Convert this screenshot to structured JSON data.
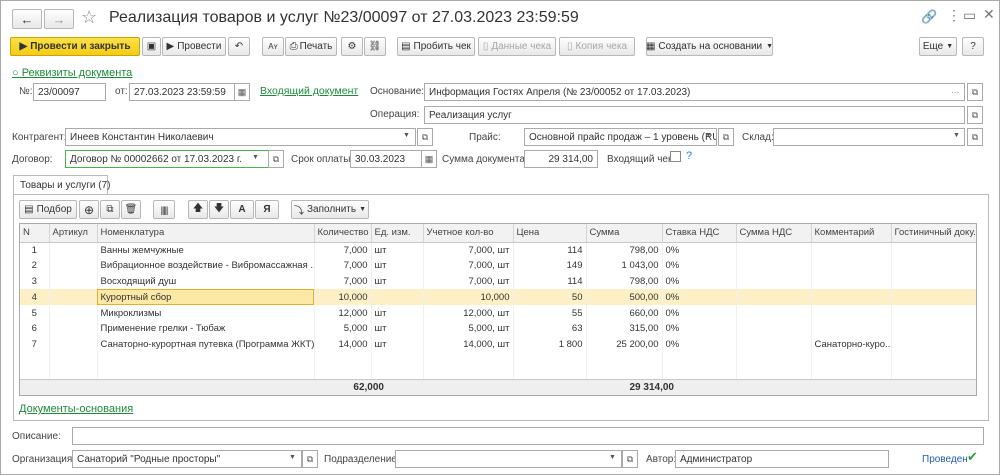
{
  "title": "Реализация товаров и услуг №23/00097 от 27.03.2023 23:59:59",
  "toolbar": {
    "post_close": "Провести и закрыть",
    "post": "Провести",
    "print": "Печать",
    "punch_check": "Пробить чек",
    "check_data": "Данные чека",
    "check_copy": "Копия чека",
    "create_based": "Создать на основании",
    "more": "Еще",
    "help": "?"
  },
  "requisites_link": "○ Реквизиты документа",
  "form": {
    "num_label": "№:",
    "num_value": "23/00097",
    "from_label": "от:",
    "date_value": "27.03.2023 23:59:59",
    "incoming_doc_link": "Входящий документ",
    "basis_label": "Основание:",
    "basis_value": "Информация Гостях Апреля (№ 23/00052 от 17.03.2023)",
    "operation_label": "Операция:",
    "operation_value": "Реализация услуг",
    "contractor_label": "Контрагент:",
    "contractor_value": "Инеев Константин Николаевич",
    "price_label": "Прайс:",
    "price_value": "Основной прайс продаж – 1 уровень (RU",
    "warehouse_label": "Склад:",
    "warehouse_value": "",
    "contract_label": "Договор:",
    "contract_value": "Договор № 00002662 от 17.03.2023 г.",
    "payment_term_label": "Срок оплаты:",
    "payment_term_value": "30.03.2023",
    "doc_sum_label": "Сумма документа:",
    "doc_sum_value": "29 314,00",
    "incoming_check_label": "Входящий чек:",
    "question": "?"
  },
  "tab": "Товары и услуги (7)",
  "table_toolbar": {
    "pick": "Подбор",
    "fill": "Заполнить",
    "a_label": "А",
    "ya_label": "Я"
  },
  "table": {
    "columns": [
      "N",
      "Артикул",
      "Номенклатура",
      "Количество",
      "Ед. изм.",
      "Учетное кол-во",
      "Цена",
      "Сумма",
      "Ставка НДС",
      "Сумма НДС",
      "Комментарий",
      "Гостиничный доку..."
    ],
    "rows": [
      [
        "1",
        "",
        "Ванны жемчужные",
        "7,000",
        "шт",
        "7,000, шт",
        "114",
        "798,00",
        "0%",
        "",
        "",
        ""
      ],
      [
        "2",
        "",
        "Вибрационное воздействие - Вибромассажная ...",
        "7,000",
        "шт",
        "7,000, шт",
        "149",
        "1 043,00",
        "0%",
        "",
        "",
        ""
      ],
      [
        "3",
        "",
        "Восходящий душ",
        "7,000",
        "шт",
        "7,000, шт",
        "114",
        "798,00",
        "0%",
        "",
        "",
        ""
      ],
      [
        "4",
        "",
        "Курортный сбор",
        "10,000",
        "",
        "10,000",
        "50",
        "500,00",
        "0%",
        "",
        "",
        ""
      ],
      [
        "5",
        "",
        "Микроклизмы",
        "12,000",
        "шт",
        "12,000, шт",
        "55",
        "660,00",
        "0%",
        "",
        "",
        ""
      ],
      [
        "6",
        "",
        "Применение грелки - Тюбаж",
        "5,000",
        "шт",
        "5,000, шт",
        "63",
        "315,00",
        "0%",
        "",
        "",
        ""
      ],
      [
        "7",
        "",
        "Санаторно-курортная путевка (Программа ЖКТ)",
        "14,000",
        "шт",
        "14,000, шт",
        "1 800",
        "25 200,00",
        "0%",
        "",
        "Санаторно-куро...",
        ""
      ]
    ],
    "selected_row": 3,
    "total_qty": "62,000",
    "total_sum": "29 314,00"
  },
  "basis_docs_link": "Документы-основания",
  "bottom": {
    "description_label": "Описание:",
    "description_value": "",
    "org_label": "Организация:",
    "org_value": "Санаторий \"Родные просторы\"",
    "division_label": "Подразделение:",
    "division_value": "",
    "author_label": "Автор:",
    "author_value": "Администратор",
    "status": "Проведен"
  },
  "colors": {
    "accent_yellow": "#f5d01e",
    "link_green": "#1e8a3c",
    "selected_row": "#fdf0c6"
  }
}
